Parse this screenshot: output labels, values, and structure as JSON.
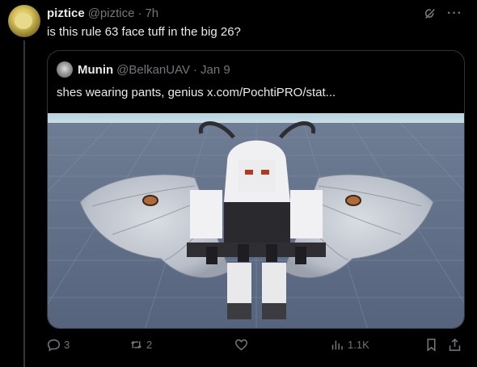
{
  "post": {
    "author_name": "piztice",
    "author_handle": "@piztice",
    "separator": "·",
    "time": "7h",
    "text": "is this rule 63 face tuff in the big 26?"
  },
  "quote": {
    "author_name": "Munin",
    "author_handle": "@BelkanUAV",
    "separator": "·",
    "time": "Jan 9",
    "text": "shes wearing pants, genius  x.com/PochtiPRO/stat..."
  },
  "actions": {
    "replies": "3",
    "reposts": "2",
    "likes": "",
    "views": "1.1K"
  },
  "icons": {
    "grok": "grok-icon",
    "more": "more-icon",
    "reply": "reply-icon",
    "repost": "repost-icon",
    "like": "heart-icon",
    "views": "views-icon",
    "bookmark": "bookmark-icon",
    "share": "share-icon"
  },
  "colors": {
    "background": "#000000",
    "text": "#e7e9ea",
    "muted": "#71767b",
    "border": "#2f3336"
  }
}
